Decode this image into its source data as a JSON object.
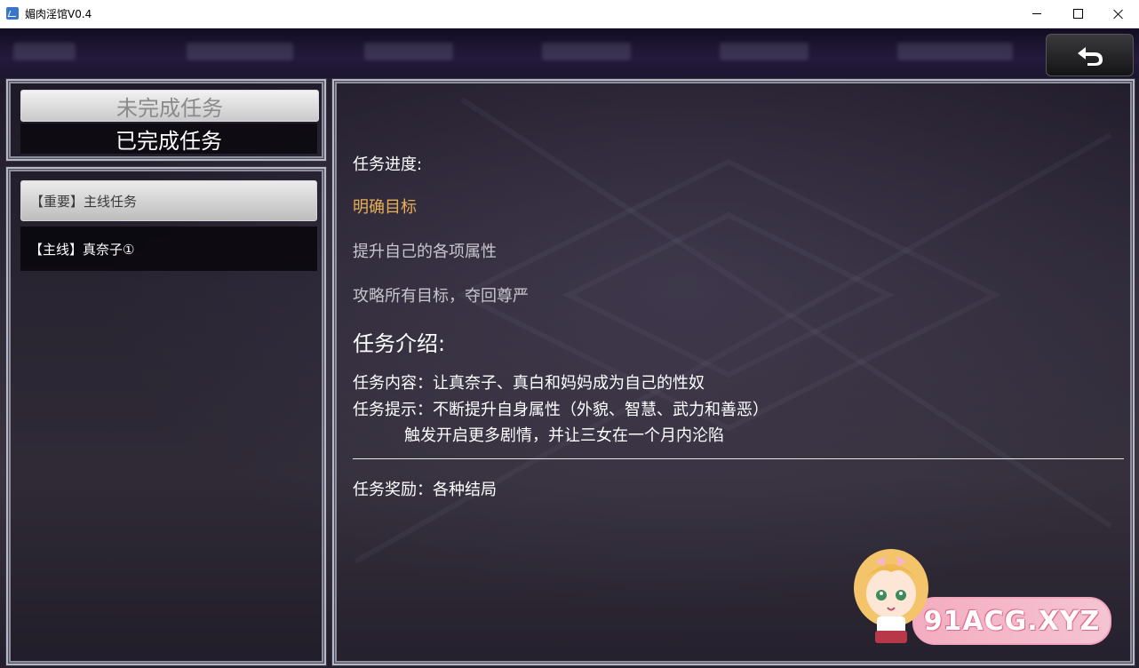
{
  "window": {
    "title": "媚肉淫馆V0.4"
  },
  "tabs": {
    "incomplete": "未完成任务",
    "completed": "已完成任务"
  },
  "quest_list": [
    {
      "label": "【重要】主线任务",
      "selected": true
    },
    {
      "label": "【主线】真奈子①",
      "selected": false
    }
  ],
  "detail": {
    "progress_heading": "任务进度:",
    "objectives": [
      {
        "text": "明确目标",
        "status": "active"
      },
      {
        "text": "提升自己的各项属性",
        "status": "pending"
      },
      {
        "text": "攻略所有目标，夺回尊严",
        "status": "pending"
      }
    ],
    "intro_heading": "任务介绍:",
    "content_line": "任务内容：让真奈子、真白和妈妈成为自己的性奴",
    "hint_line": "任务提示：不断提升自身属性（外貌、智慧、武力和善恶）",
    "hint_line2": "触发开启更多剧情，并让三女在一个月内沦陷",
    "reward_line": "任务奖励：各种结局"
  },
  "watermark": {
    "text": "91ACG.XYZ"
  },
  "colors": {
    "objective_active": "#e8b056",
    "objective_pending": "#c8c6cc",
    "panel_border": "#b7b9c6"
  },
  "icons": {
    "back": "return-arrow-icon",
    "app": "app-icon"
  }
}
